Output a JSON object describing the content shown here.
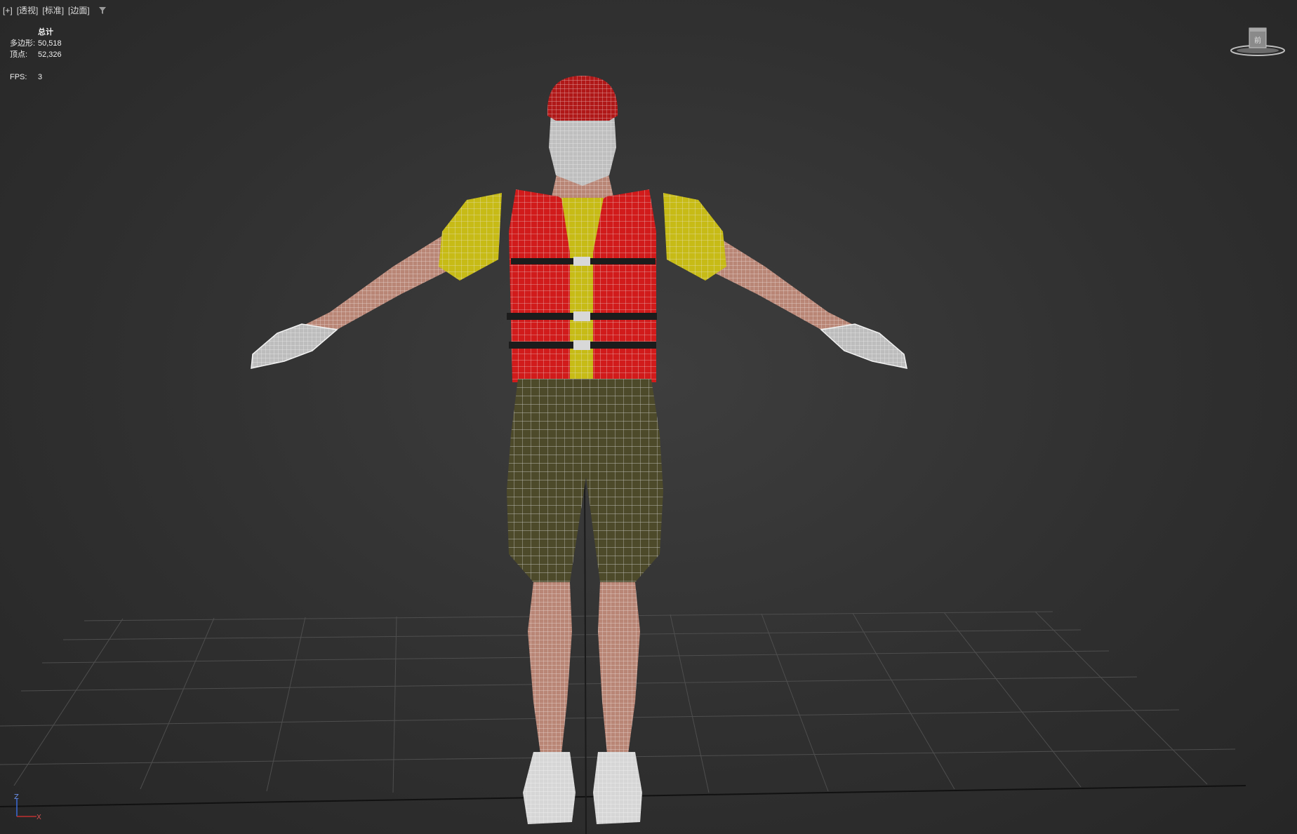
{
  "viewport": {
    "labels": [
      "[+]",
      "[透视]",
      "[标准]",
      "[边面]"
    ]
  },
  "stats": {
    "header": "总计",
    "polygons_label": "多边形:",
    "polygons_value": "50,518",
    "vertices_label": "顶点:",
    "vertices_value": "52,326",
    "fps_label": "FPS:",
    "fps_value": "3"
  },
  "viewcube": {
    "face_label": "前"
  },
  "axis": {
    "z_label": "Z",
    "x_label": "X"
  },
  "icons": {
    "filter": "filter-icon",
    "viewcube": "viewcube-icon",
    "axis_tripod": "axis-tripod-icon"
  },
  "colors": {
    "background": "#303030",
    "grid": "#4a4a4a",
    "wire": "#e6e6e6",
    "vest_red": "#d21c1c",
    "shirt_yellow": "#c9bd17",
    "shorts_olive": "#4d4a2a",
    "skin": "#b9877a",
    "cap_red": "#b01818"
  }
}
